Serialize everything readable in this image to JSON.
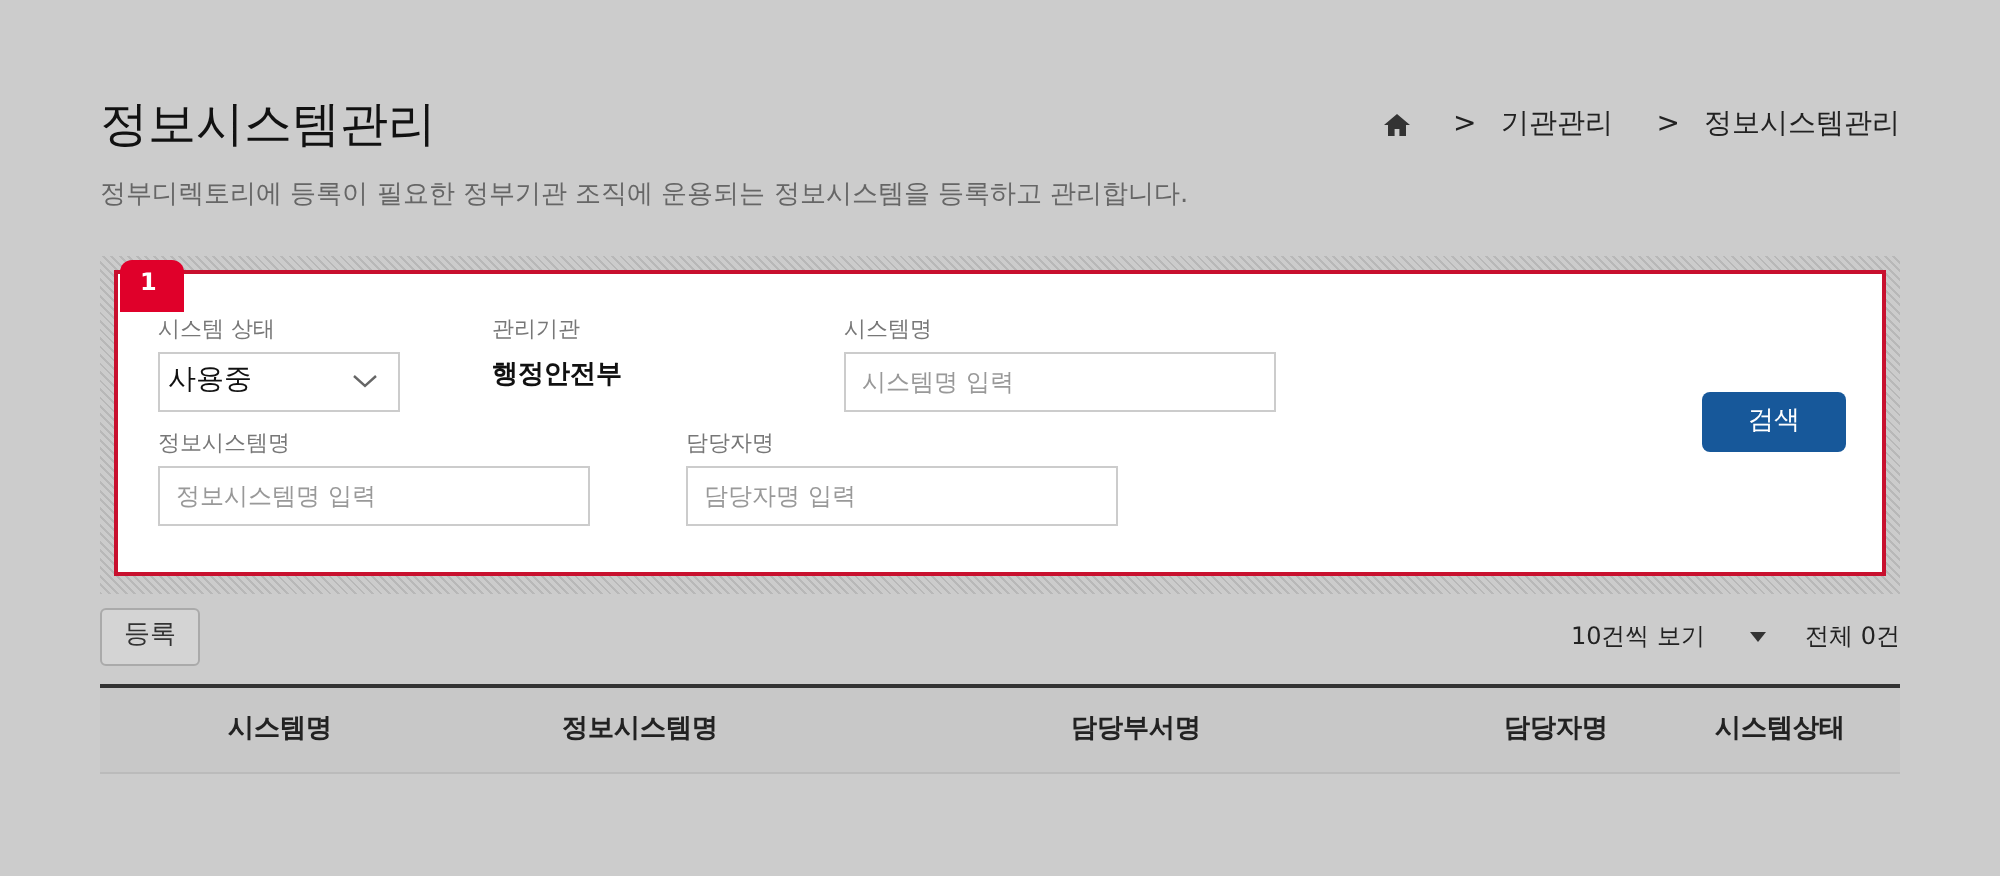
{
  "page_title": "정보시스템관리",
  "breadcrumb": [
    {
      "kind": "home"
    },
    {
      "kind": "link",
      "label": "기관관리"
    },
    {
      "kind": "link",
      "label": "정보시스템관리"
    }
  ],
  "breadcrumb_separator": ">",
  "description": "정부디렉토리에 등록이 필요한 정부기관 조직에 운용되는 정보시스템을 등록하고 관리합니다.",
  "annotation_badge": "1",
  "search_panel": {
    "rows": [
      [
        {
          "kind": "select",
          "label": "시스템 상태",
          "value": "사용중"
        },
        {
          "kind": "text",
          "label": "관리기관",
          "value": "행정안전부"
        },
        {
          "kind": "input",
          "label": "시스템명",
          "placeholder": "시스템명 입력"
        }
      ],
      [
        {
          "kind": "input",
          "label": "정보시스템명",
          "placeholder": "정보시스템명 입력"
        },
        {
          "kind": "input",
          "label": "담당자명",
          "placeholder": "담당자명 입력"
        }
      ]
    ],
    "search_button": "검색"
  },
  "register_button": "등록",
  "page_size": "10건씩 보기",
  "total": "전체 0건",
  "table": {
    "columns": [
      "시스템명",
      "정보시스템명",
      "담당부서명",
      "담당자명",
      "시스템상태"
    ]
  }
}
